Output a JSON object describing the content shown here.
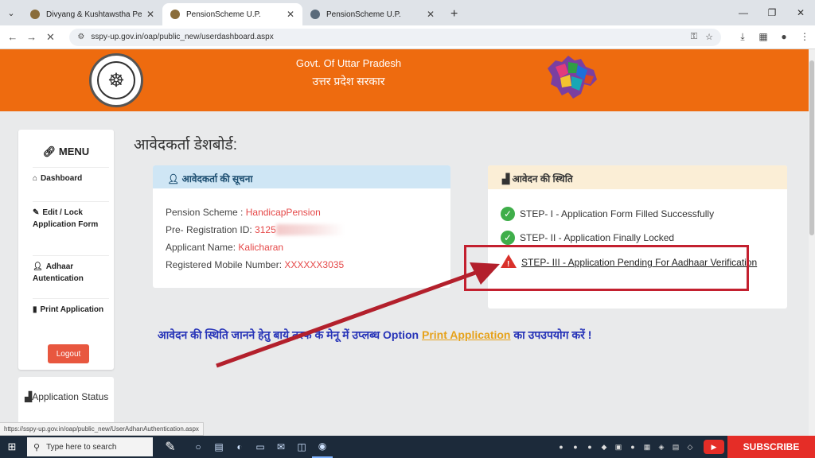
{
  "browser": {
    "tabs": [
      {
        "title": "Divyang & Kushtawstha Pensio",
        "active": false
      },
      {
        "title": "PensionScheme U.P.",
        "active": true
      },
      {
        "title": "PensionScheme U.P.",
        "active": false
      }
    ],
    "url": "sspy-up.gov.in/oap/public_new/userdashboard.aspx",
    "status_url": "https://sspy-up.gov.in/oap/public_new/UserAdhanAuthentication.aspx"
  },
  "header": {
    "title_en": "Govt. Of Uttar Pradesh",
    "title_hi": "उत्तर प्रदेश सरकार",
    "brand_color": "#ee6b0f"
  },
  "sidebar": {
    "menu_title": "MENU",
    "items": [
      {
        "icon": "home-icon",
        "label": "Dashboard"
      },
      {
        "icon": "edit-icon",
        "label": "Edit / Lock Application Form"
      },
      {
        "icon": "user-icon",
        "label": "Adhaar Autentication"
      },
      {
        "icon": "document-icon",
        "label": "Print Application"
      }
    ],
    "logout_label": "Logout",
    "status_label": "Application Status"
  },
  "main": {
    "page_title": "आवेदकर्ता डेशबोर्ड:",
    "applicant_panel": {
      "heading": "आवेदकर्ता की सूचना",
      "scheme_label": "Pension Scheme :",
      "scheme_value": "HandicapPension",
      "regid_label": "Pre- Registration ID:",
      "regid_value": "3125",
      "name_label": "Applicant Name:",
      "name_value": "Kalicharan",
      "mobile_label": "Registered Mobile Number:",
      "mobile_value": "XXXXXX3035"
    },
    "status_panel": {
      "heading": "आवेदन की स्थिति",
      "steps": [
        {
          "label": "STEP- I - Application Form Filled Successfully",
          "state": "done"
        },
        {
          "label": "STEP- II - Application Finally Locked",
          "state": "done"
        },
        {
          "label": "STEP- III - Application Pending For Aadhaar Verification",
          "state": "pending"
        }
      ]
    },
    "instruction_pre": "आवेदन की स्थिति जानने हेतु बाये तरफ के मेनू में उप्लब्ध Option",
    "instruction_link": "Print Application",
    "instruction_post": "का उपउपयोग करें !"
  },
  "taskbar": {
    "search_placeholder": "Type here to search",
    "subscribe_label": "SUBSCRIBE"
  }
}
